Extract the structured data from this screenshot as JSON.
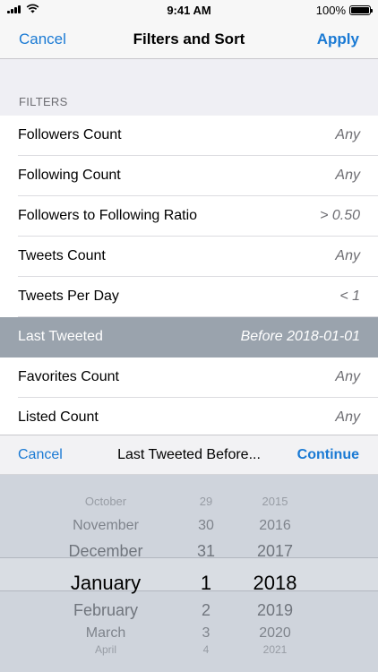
{
  "status_bar": {
    "time": "9:41 AM",
    "battery": "100%",
    "icons": [
      "signal-icon",
      "wifi-icon",
      "battery-icon"
    ]
  },
  "nav": {
    "cancel": "Cancel",
    "title": "Filters and Sort",
    "apply": "Apply"
  },
  "colors": {
    "accent": "#1a7ad4",
    "selected_row": "#9aa3ad",
    "picker_background": "#cfd4dc"
  },
  "filters": {
    "header": "FILTERS",
    "rows": [
      {
        "label": "Followers Count",
        "value": "Any"
      },
      {
        "label": "Following Count",
        "value": "Any"
      },
      {
        "label": "Followers to Following Ratio",
        "value": "> 0.50"
      },
      {
        "label": "Tweets Count",
        "value": "Any"
      },
      {
        "label": "Tweets Per Day",
        "value": "< 1"
      },
      {
        "label": "Last Tweeted",
        "value": "Before 2018-01-01",
        "selected": true
      },
      {
        "label": "Favorites Count",
        "value": "Any"
      },
      {
        "label": "Listed Count",
        "value": "Any"
      }
    ]
  },
  "picker_toolbar": {
    "cancel": "Cancel",
    "title": "Last Tweeted Before...",
    "continue": "Continue"
  },
  "date_picker": {
    "months": [
      "October",
      "November",
      "December",
      "January",
      "February",
      "March",
      "April"
    ],
    "days": [
      "29",
      "30",
      "31",
      "1",
      "2",
      "3",
      "4"
    ],
    "years": [
      "2015",
      "2016",
      "2017",
      "2018",
      "2019",
      "2020",
      "2021"
    ],
    "selected_index": 3
  }
}
